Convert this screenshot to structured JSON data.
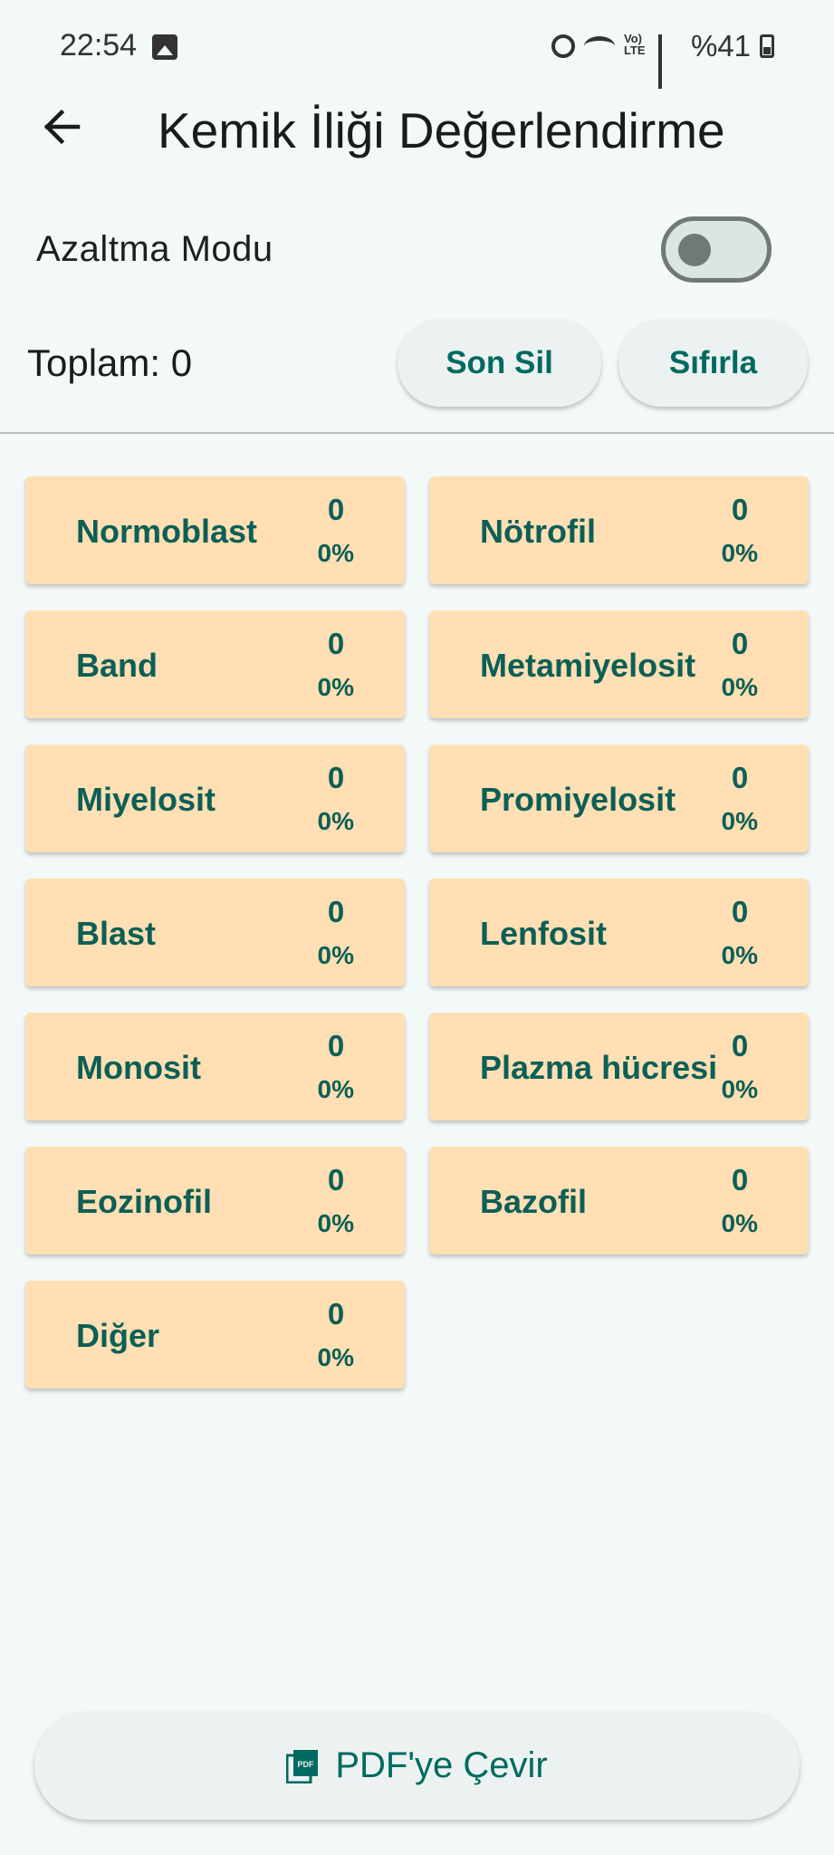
{
  "status_bar": {
    "time": "22:54",
    "battery": "%41",
    "volte": "Vo) LTE"
  },
  "header": {
    "title": "Kemik İliği Değerlendirme"
  },
  "mode": {
    "label": "Azaltma Modu",
    "enabled": false
  },
  "totals": {
    "label": "Toplam:  0",
    "undo_label": "Son Sil",
    "reset_label": "Sıfırla"
  },
  "cells": [
    {
      "name": "Normoblast",
      "count": "0",
      "percent": "0%"
    },
    {
      "name": "Nötrofil",
      "count": "0",
      "percent": "0%"
    },
    {
      "name": "Band",
      "count": "0",
      "percent": "0%"
    },
    {
      "name": "Metamiyelosit",
      "count": "0",
      "percent": "0%"
    },
    {
      "name": "Miyelosit",
      "count": "0",
      "percent": "0%"
    },
    {
      "name": "Promiyelosit",
      "count": "0",
      "percent": "0%"
    },
    {
      "name": "Blast",
      "count": "0",
      "percent": "0%"
    },
    {
      "name": "Lenfosit",
      "count": "0",
      "percent": "0%"
    },
    {
      "name": "Monosit",
      "count": "0",
      "percent": "0%"
    },
    {
      "name": "Plazma hücresi",
      "count": "0",
      "percent": "0%"
    },
    {
      "name": "Eozinofil",
      "count": "0",
      "percent": "0%"
    },
    {
      "name": "Bazofil",
      "count": "0",
      "percent": "0%"
    },
    {
      "name": "Diğer",
      "count": "0",
      "percent": "0%"
    }
  ],
  "footer": {
    "pdf_label": "PDF'ye Çevir"
  },
  "colors": {
    "background": "#f3f9f8",
    "cell": "#ffdfb3",
    "accent": "#006a60",
    "cell_text": "#0c5f56"
  },
  "icons": {
    "back": "arrow-left-icon",
    "pdf": "pdf-file-icon"
  }
}
